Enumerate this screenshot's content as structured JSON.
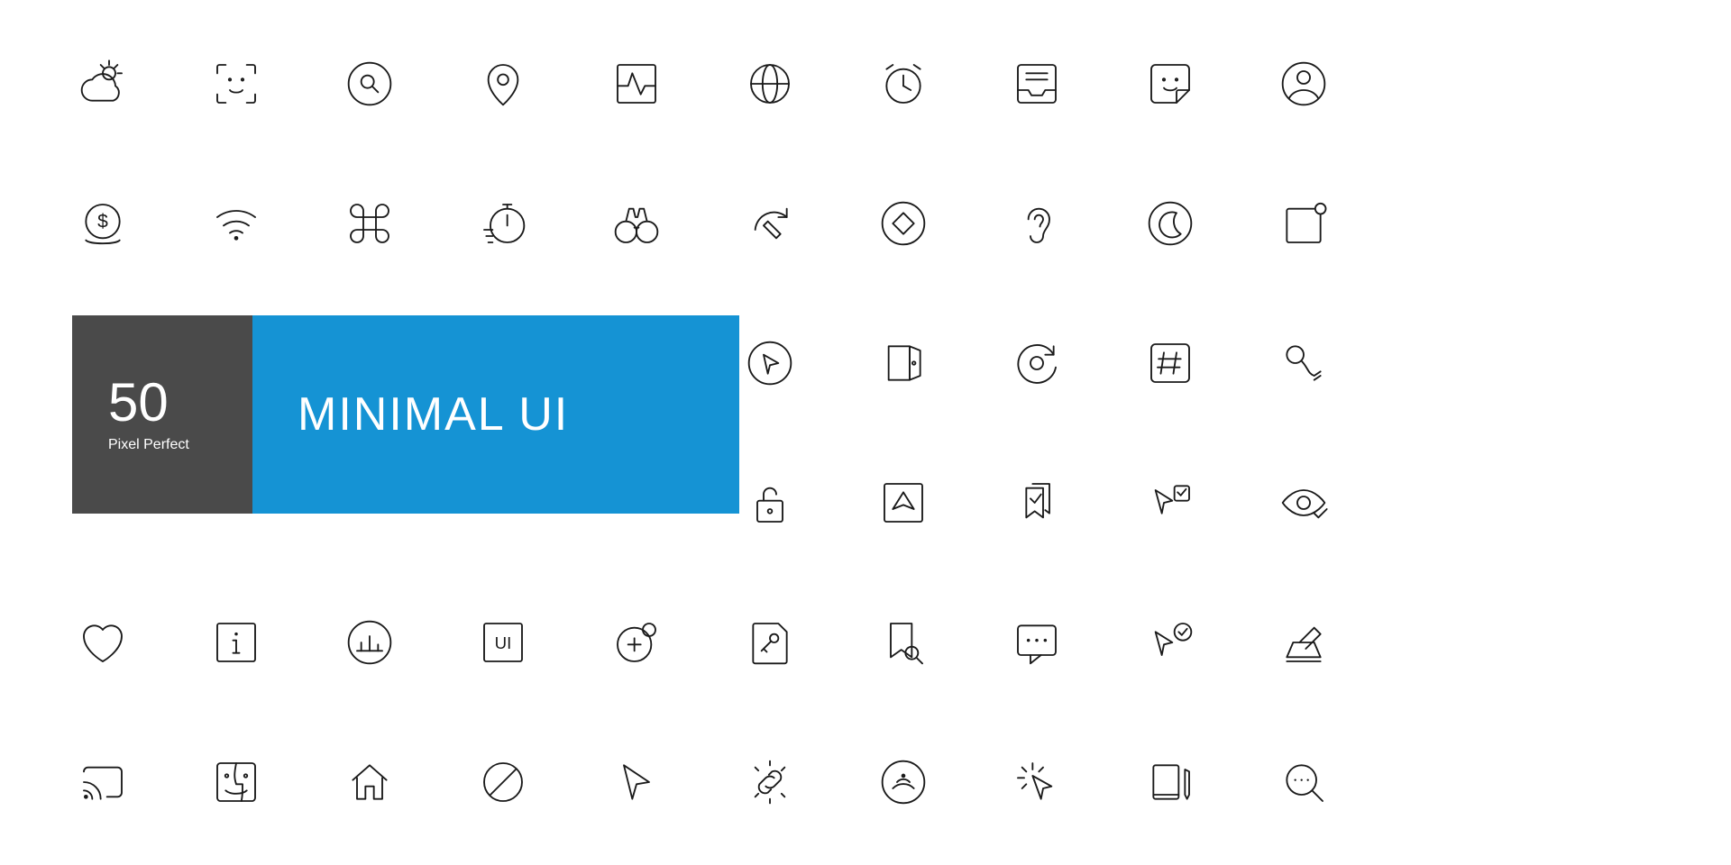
{
  "badge": {
    "count": "50",
    "subtitle": "Pixel Perfect",
    "title": "MINIMAL UI"
  },
  "icons": {
    "row1": [
      "weather",
      "face-id",
      "search-circle",
      "location-pin",
      "activity",
      "globe",
      "clock",
      "inbox",
      "sticker-smile",
      "user-circle"
    ],
    "row2": [
      "coin-dollar",
      "wifi",
      "command",
      "stopwatch",
      "binoculars",
      "edit-redo",
      "tag",
      "ear",
      "dark-mode",
      "notification-badge"
    ],
    "row3": [
      "",
      "",
      "",
      "",
      "",
      "cursor-circle",
      "door-exit",
      "refresh-search",
      "hashtag",
      "microphone"
    ],
    "row4": [
      "",
      "",
      "",
      "",
      "",
      "unlock",
      "send",
      "bookmarks",
      "cursor-select",
      "eye-check"
    ],
    "row5": [
      "heart",
      "info",
      "chart-circle",
      "ui-box",
      "add-notification",
      "key-note",
      "bookmark-search",
      "chat-typing",
      "cursor-verified",
      "scanner"
    ],
    "row6": [
      "cast",
      "finder",
      "home",
      "block",
      "cursor",
      "link-click",
      "signal",
      "cursor-click",
      "notebook-pencil",
      "search-more"
    ]
  }
}
